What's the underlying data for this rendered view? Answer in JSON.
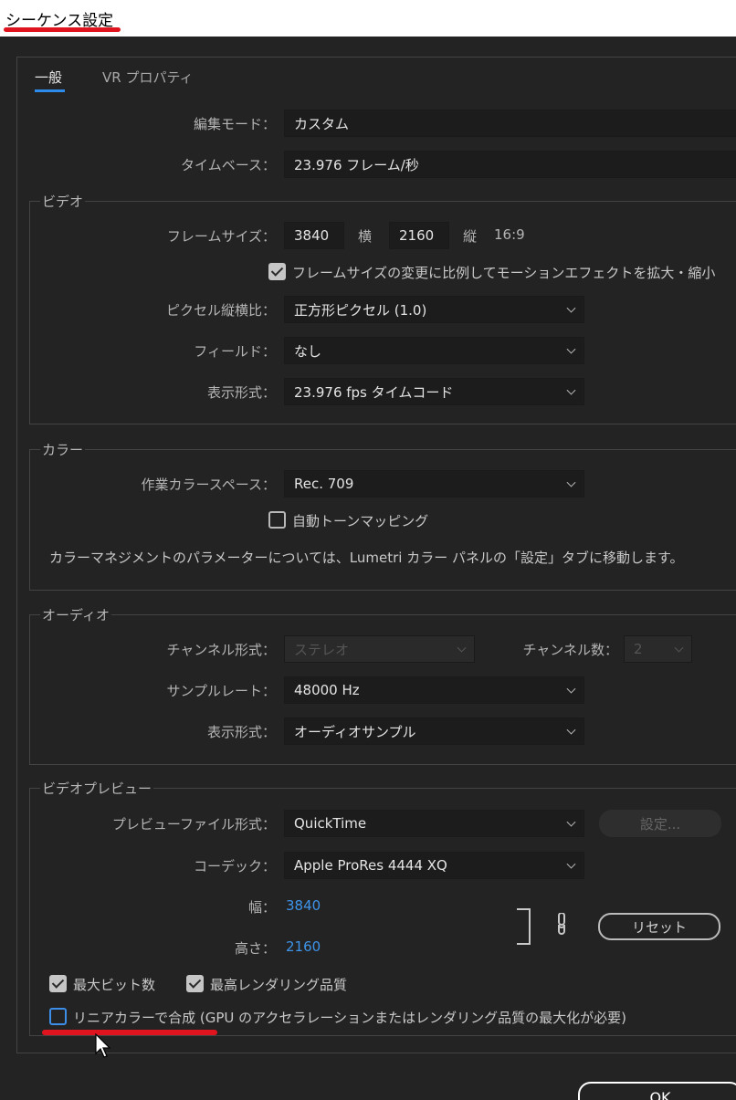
{
  "window": {
    "title": "シーケンス設定"
  },
  "tabs": [
    {
      "label": "一般",
      "active": true
    },
    {
      "label": "VR プロパティ",
      "active": false
    }
  ],
  "general": {
    "edit_mode": {
      "label": "編集モード：",
      "value": "カスタム"
    },
    "timebase": {
      "label": "タイムベース：",
      "value": "23.976  フレーム/秒"
    }
  },
  "video": {
    "legend": "ビデオ",
    "frame_size": {
      "label": "フレームサイズ：",
      "width": "3840",
      "width_unit": "横",
      "height": "2160",
      "height_unit": "縦",
      "aspect": "16:9"
    },
    "scale_motion": {
      "label": "フレームサイズの変更に比例してモーションエフェクトを拡大・縮小",
      "checked": true
    },
    "pixel_aspect": {
      "label": "ピクセル縦横比：",
      "value": "正方形ピクセル (1.0)"
    },
    "fields": {
      "label": "フィールド：",
      "value": "なし"
    },
    "display_format": {
      "label": "表示形式：",
      "value": "23.976  fps タイムコード"
    }
  },
  "color": {
    "legend": "カラー",
    "working_space": {
      "label": "作業カラースペース：",
      "value": "Rec. 709"
    },
    "auto_tone_mapping": {
      "label": "自動トーンマッピング",
      "checked": false
    },
    "info": "カラーマネジメントのパラメーターについては、Lumetri カラー パネルの「設定」タブに移動します。"
  },
  "audio": {
    "legend": "オーディオ",
    "channel_format": {
      "label": "チャンネル形式：",
      "value": "ステレオ"
    },
    "channel_count": {
      "label": "チャンネル数：",
      "value": "2"
    },
    "sample_rate": {
      "label": "サンプルレート：",
      "value": "48000 Hz"
    },
    "display_format": {
      "label": "表示形式：",
      "value": "オーディオサンプル"
    }
  },
  "preview": {
    "legend": "ビデオプレビュー",
    "file_format": {
      "label": "プレビューファイル形式：",
      "value": "QuickTime"
    },
    "settings_button": "設定...",
    "codec": {
      "label": "コーデック：",
      "value": "Apple ProRes 4444 XQ"
    },
    "width": {
      "label": "幅：",
      "value": "3840"
    },
    "height": {
      "label": "高さ：",
      "value": "2160"
    },
    "reset_button": "リセット",
    "max_bit_depth": {
      "label": "最大ビット数",
      "checked": true
    },
    "max_render_quality": {
      "label": "最高レンダリング品質",
      "checked": true
    },
    "linear_color": {
      "label": "リニアカラーで合成 (GPU のアクセラレーションまたはレンダリング品質の最大化が必要)",
      "checked": false
    }
  },
  "footer": {
    "ok_button": "OK"
  },
  "colors": {
    "accent": "#2d8ceb",
    "highlight": "#e0141e",
    "background": "#232323"
  }
}
